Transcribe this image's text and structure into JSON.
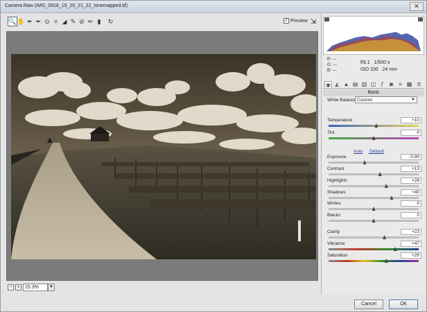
{
  "window": {
    "title": "Camera Raw (IMG_0918_19_20_21_22_tonemapped.tif)",
    "close_glyph": "✕"
  },
  "toolbar": {
    "tools": [
      {
        "name": "zoom-tool-icon",
        "glyph": "🔍"
      },
      {
        "name": "hand-tool-icon",
        "glyph": "✋"
      },
      {
        "name": "white-balance-tool-icon",
        "glyph": "✒"
      },
      {
        "name": "color-sampler-tool-icon",
        "glyph": "✒"
      },
      {
        "name": "targeted-adjustment-tool-icon",
        "glyph": "⊙"
      },
      {
        "name": "crop-tool-icon",
        "glyph": "⌗"
      },
      {
        "name": "straighten-tool-icon",
        "glyph": "◢"
      },
      {
        "name": "spot-removal-tool-icon",
        "glyph": "✎"
      },
      {
        "name": "red-eye-tool-icon",
        "glyph": "⊘"
      },
      {
        "name": "adjustment-brush-icon",
        "glyph": "✏"
      },
      {
        "name": "graduated-filter-icon",
        "glyph": "▮"
      },
      {
        "name": "rotate-icon",
        "glyph": "↻"
      }
    ],
    "preview_label": "Preview",
    "preview_checked": "✓",
    "fullscreen_glyph": "⇲"
  },
  "zoom": {
    "minus": "−",
    "plus": "+",
    "value": "15.3%",
    "dropdown_glyph": "▼"
  },
  "info": {
    "r": "R:  ---",
    "g": "G:  ---",
    "b": "B:  ---",
    "aperture": "f/9.1",
    "shutter": "1/500 s",
    "iso": "ISO 100",
    "focal": "24 mm"
  },
  "panel": {
    "title": "Basic",
    "white_balance_label": "White Balance:",
    "white_balance_value": "Custom",
    "auto_link": "Auto",
    "default_link": "Default",
    "sliders": [
      {
        "label": "Temperature",
        "value": "+10",
        "pos": 0.53
      },
      {
        "label": "Tint",
        "value": "0",
        "pos": 0.5
      },
      {
        "label": "Exposure",
        "value": "-0.90",
        "pos": 0.4
      },
      {
        "label": "Contrast",
        "value": "+13",
        "pos": 0.57
      },
      {
        "label": "Highlights",
        "value": "+28",
        "pos": 0.64
      },
      {
        "label": "Shadows",
        "value": "+40",
        "pos": 0.7
      },
      {
        "label": "Whites",
        "value": "0",
        "pos": 0.5
      },
      {
        "label": "Blacks",
        "value": "0",
        "pos": 0.5
      },
      {
        "label": "Clarity",
        "value": "+23",
        "pos": 0.62
      },
      {
        "label": "Vibrance",
        "value": "+47",
        "pos": 0.74
      },
      {
        "label": "Saturation",
        "value": "+29",
        "pos": 0.64
      }
    ]
  },
  "buttons": {
    "cancel": "Cancel",
    "ok": "OK"
  },
  "colors": {
    "accent": "#2a3f9e"
  }
}
